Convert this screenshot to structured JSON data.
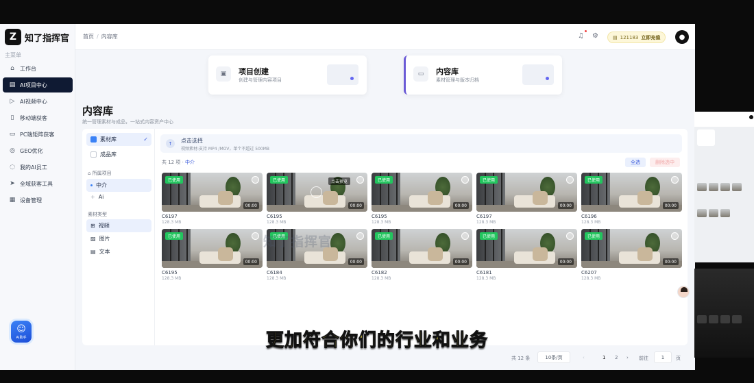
{
  "brand": {
    "name": "知了指挥官",
    "mark": "Z"
  },
  "sidebar": {
    "caption": "主菜单",
    "items": [
      {
        "label": "工作台",
        "icon": "home-icon",
        "glyph": "⌂",
        "active": false
      },
      {
        "label": "AI项目中心",
        "icon": "document-icon",
        "glyph": "▤",
        "active": true
      },
      {
        "label": "AI视频中心",
        "icon": "video-icon",
        "glyph": "▷",
        "active": false
      },
      {
        "label": "移动端获客",
        "icon": "mobile-icon",
        "glyph": "▯",
        "active": false
      },
      {
        "label": "PC端矩阵获客",
        "icon": "monitor-icon",
        "glyph": "▭",
        "active": false
      },
      {
        "label": "GEO优化",
        "icon": "globe-icon",
        "glyph": "◎",
        "active": false
      },
      {
        "label": "我的AI员工",
        "icon": "chat-icon",
        "glyph": "◌",
        "active": false
      },
      {
        "label": "全域获客工具",
        "icon": "send-icon",
        "glyph": "➤",
        "active": false
      },
      {
        "label": "设备管理",
        "icon": "grid-icon",
        "glyph": "▦",
        "active": false
      }
    ],
    "bot_label": "AI助手"
  },
  "topbar": {
    "breadcrumb": [
      "首页",
      "内容库"
    ],
    "credits": "121183",
    "recharge_label": "立即充值"
  },
  "cards": [
    {
      "title": "项目创建",
      "subtitle": "创建与管理内容项目",
      "icon": "project-icon",
      "glyph": "▣"
    },
    {
      "title": "内容库",
      "subtitle": "素材管理与版本归档",
      "icon": "folder-icon",
      "glyph": "▭"
    }
  ],
  "page": {
    "title": "内容库",
    "subtitle": "统一管理素材与成品，一站式内容资产中心"
  },
  "library": {
    "tabs": [
      {
        "label": "素材库",
        "selected": true
      },
      {
        "label": "成品库",
        "selected": false
      }
    ],
    "project_caption": "所属项目",
    "projects": [
      {
        "label": "中介",
        "selected": true
      },
      {
        "label": "Ai",
        "selected": false
      }
    ],
    "type_caption": "素材类型",
    "types": [
      {
        "label": "视频",
        "glyph": "⊞",
        "selected": true
      },
      {
        "label": "图片",
        "glyph": "▨",
        "selected": false
      },
      {
        "label": "文本",
        "glyph": "▤",
        "selected": false
      }
    ]
  },
  "uploader": {
    "title": "点击选择",
    "hint": "视频素材:支持 MP4 /MOV，单个不超过 500MB"
  },
  "list": {
    "count_text": "共 12 项 ·",
    "filter": "中介",
    "select_all": "全选",
    "batch_delete": "删除选中"
  },
  "tiles": [
    {
      "name": "C6197",
      "size": "128.3 MB",
      "badge": "已使用",
      "duration": "00:00",
      "preview": ""
    },
    {
      "name": "C6195",
      "size": "128.3 MB",
      "badge": "已使用",
      "duration": "00:00",
      "preview": "点击预览"
    },
    {
      "name": "C6195",
      "size": "128.3 MB",
      "badge": "已使用",
      "duration": "00:00",
      "preview": ""
    },
    {
      "name": "C6197",
      "size": "128.3 MB",
      "badge": "已使用",
      "duration": "00:00",
      "preview": ""
    },
    {
      "name": "C6196",
      "size": "128.3 MB",
      "badge": "已使用",
      "duration": "00:00",
      "preview": ""
    },
    {
      "name": "C6195",
      "size": "128.3 MB",
      "badge": "已使用",
      "duration": "00:00",
      "preview": ""
    },
    {
      "name": "C6184",
      "size": "128.3 MB",
      "badge": "已使用",
      "duration": "00:00",
      "preview": ""
    },
    {
      "name": "C6182",
      "size": "128.3 MB",
      "badge": "已使用",
      "duration": "00:00",
      "preview": ""
    },
    {
      "name": "C6181",
      "size": "128.3 MB",
      "badge": "已使用",
      "duration": "00:00",
      "preview": ""
    },
    {
      "name": "C6207",
      "size": "128.3 MB",
      "badge": "已使用",
      "duration": "00:00",
      "preview": ""
    }
  ],
  "pagination": {
    "total": "共 12 条",
    "page_size": "10条/页",
    "pages": [
      "1",
      "2"
    ],
    "goto_label": "前往",
    "goto_value": "1",
    "page_suffix": "页"
  },
  "watermark": "知了指挥官",
  "subtitle_caption": "更加符合你们的行业和业务",
  "colors": {
    "accent": "#3b5bdb",
    "active_nav": "#0f1a33",
    "used_badge": "#22c55e",
    "caption": "#f6e24a"
  }
}
